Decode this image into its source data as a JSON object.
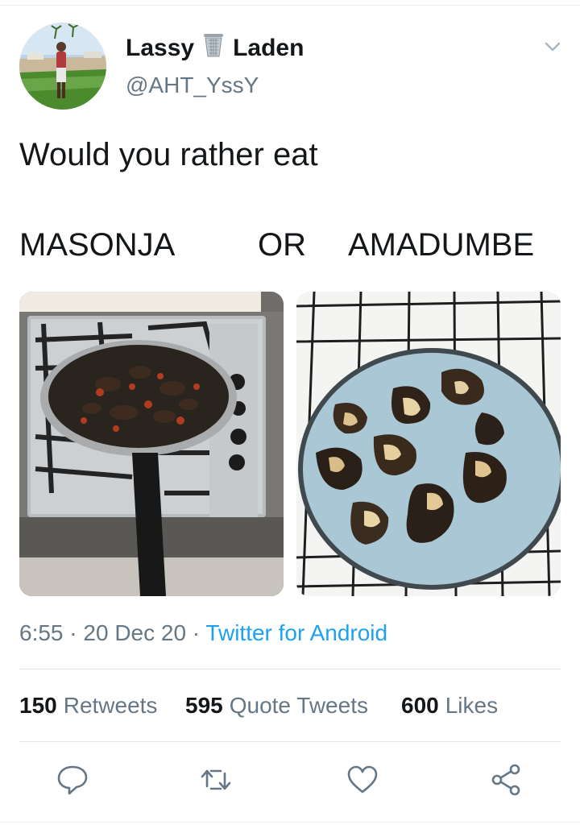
{
  "tweet": {
    "author": {
      "name_first": "Lassy",
      "name_emoji": "wastebasket-icon",
      "name_last": "Laden",
      "handle": "@AHT_YssY"
    },
    "text_line1": "Would you rather eat",
    "text_line2": {
      "option_a": "MASONJA",
      "connector": "OR",
      "option_b": "AMADUMBE"
    },
    "media": [
      {
        "icon": "pan-of-masonja-photo"
      },
      {
        "icon": "plate-of-amadumbe-photo"
      }
    ],
    "meta": {
      "time": "6:55",
      "sep1": " · ",
      "date": "20 Dec 20",
      "sep2": " · ",
      "source": "Twitter for Android"
    },
    "stats": {
      "retweets_count": "150",
      "retweets_label": "Retweets",
      "quotes_count": "595",
      "quotes_label": "Quote Tweets",
      "likes_count": "600",
      "likes_label": "Likes"
    },
    "actions": [
      "reply-icon",
      "retweet-icon",
      "like-icon",
      "share-icon"
    ],
    "colors": {
      "text": "#14171a",
      "secondary": "#657786",
      "link": "#1da1f2",
      "divider": "#e1e8ed"
    }
  }
}
